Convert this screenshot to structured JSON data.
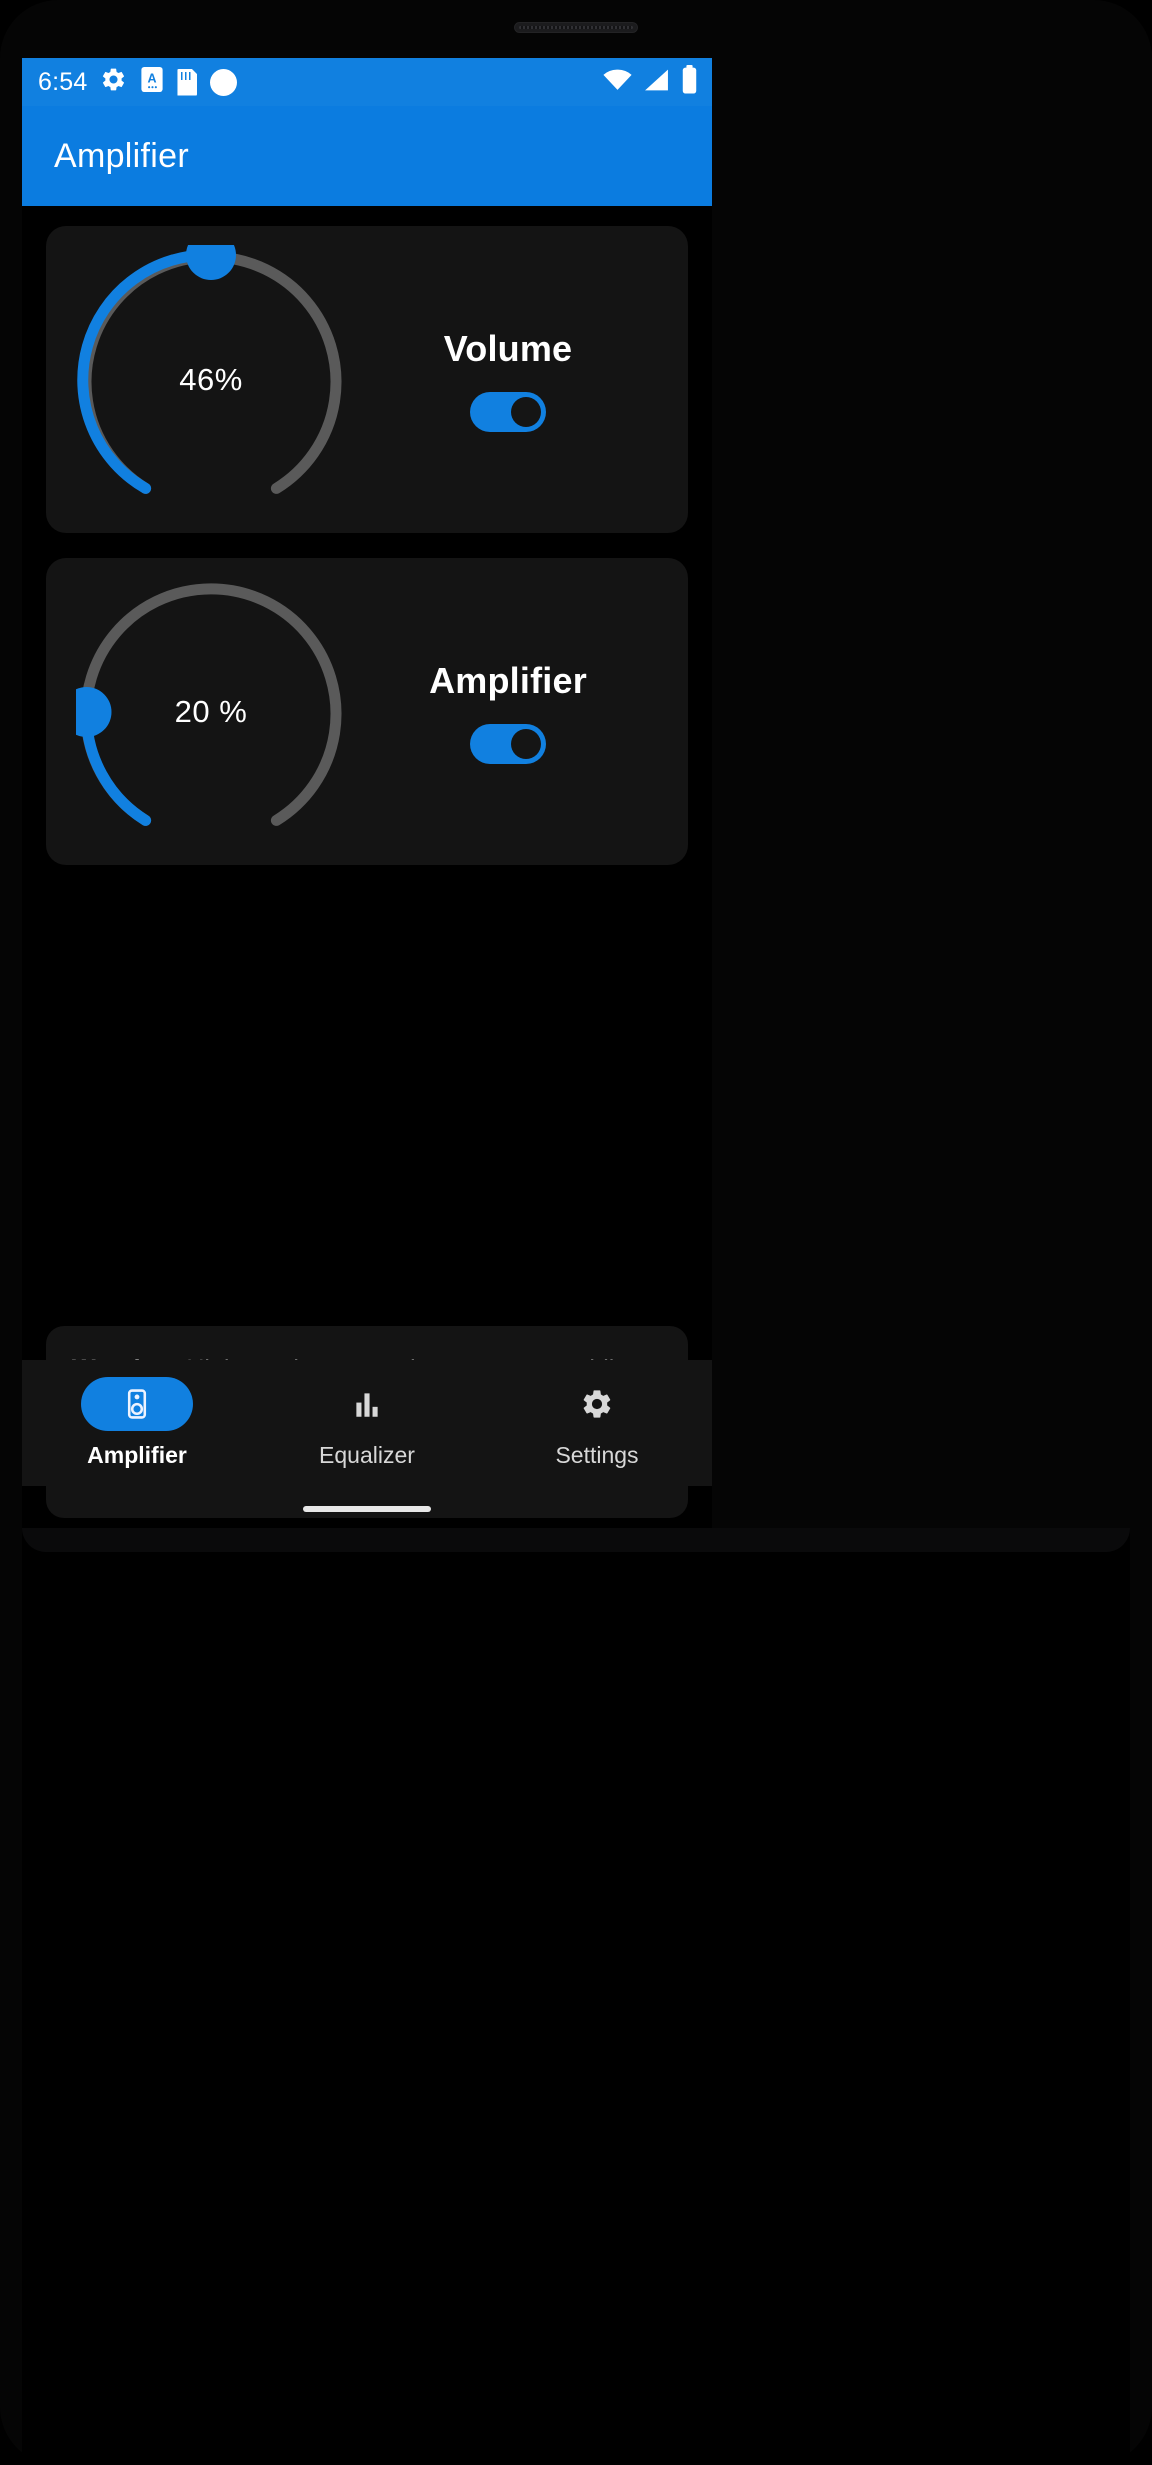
{
  "statusbar": {
    "clock": "6:54",
    "icons_left": [
      "gear-icon",
      "text-a-badge-icon",
      "sd-card-icon",
      "circle-dot-icon"
    ],
    "icons_right": [
      "wifi-icon",
      "cellular-signal-icon",
      "battery-icon"
    ]
  },
  "appbar": {
    "title": "Amplifier",
    "background": "#0b7ce0"
  },
  "theme": {
    "accent": "#1180e0",
    "card_bg": "#141414",
    "track": "#5a5a5a",
    "page_bg": "#000000"
  },
  "cards": [
    {
      "id": "volume",
      "label": "Volume",
      "value_text": "46%",
      "percent": 46,
      "toggle_on": true,
      "knob_handle": "volume-knob-handle"
    },
    {
      "id": "amplifier",
      "label": "Amplifier",
      "value_text": "20 %",
      "percent": 20,
      "toggle_on": true,
      "knob_handle": "amplifier-knob-handle"
    }
  ],
  "warning": {
    "label": "Warning:",
    "body": " Higher volume can damage your mobile speaker and using Volume Amplifier with headphones can damage your ears. Please use this app with precaution."
  },
  "bottom_nav": {
    "items": [
      {
        "label": "Amplifier",
        "icon": "speaker-icon",
        "active": true
      },
      {
        "label": "Equalizer",
        "icon": "equalizer-bars-icon",
        "active": false
      },
      {
        "label": "Settings",
        "icon": "gear-icon",
        "active": false
      }
    ]
  }
}
